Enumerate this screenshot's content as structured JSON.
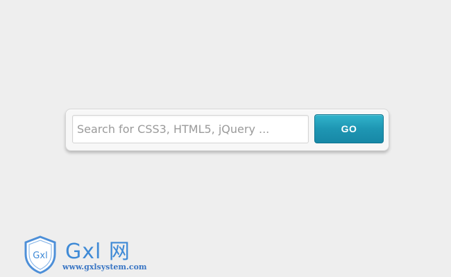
{
  "search": {
    "placeholder": "Search for CSS3, HTML5, jQuery ...",
    "value": "",
    "button_label": "GO"
  },
  "watermark": {
    "logo_text": "Gxl",
    "brand": "Gxl 网",
    "url": "www.gxlsystem.com",
    "icon": "shield-icon"
  },
  "colors": {
    "background": "#eeeeee",
    "button_accent": "#1e96b3",
    "brand": "#3f8ad6"
  }
}
